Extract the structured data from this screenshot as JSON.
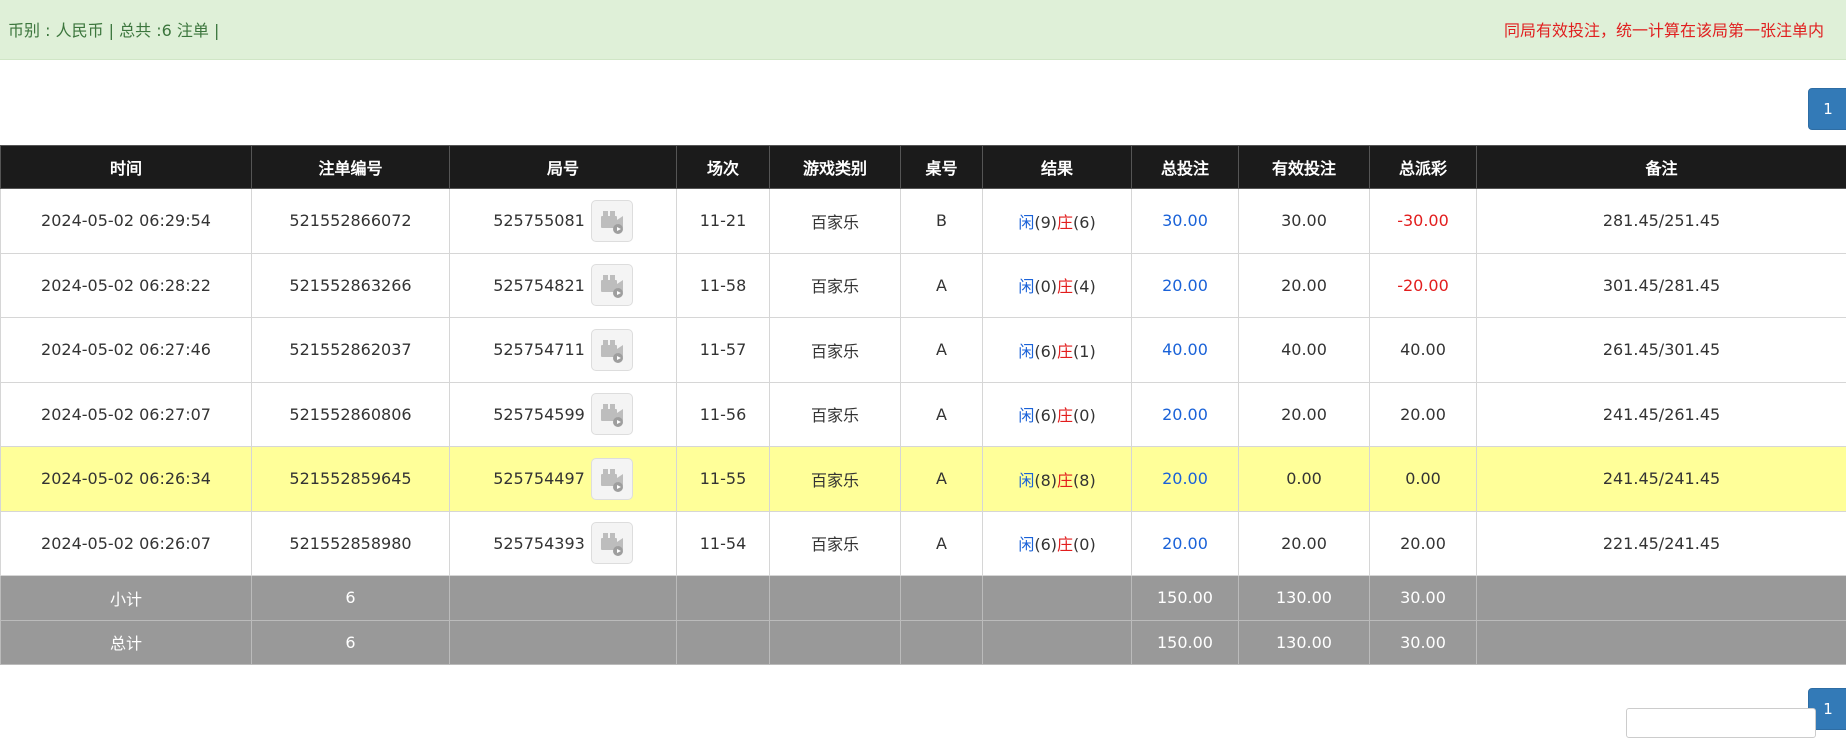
{
  "topbar": {
    "summary": "币别 : 人民币 | 总共 :6 注单 |",
    "notice": "同局有效投注，统一计算在该局第一张注单内"
  },
  "pagination": {
    "current_page": "1"
  },
  "table": {
    "headers": [
      "时间",
      "注单编号",
      "局号",
      "场次",
      "游戏类别",
      "桌号",
      "结果",
      "总投注",
      "有效投注",
      "总派彩",
      "备注"
    ],
    "rows": [
      {
        "time": "2024-05-02 06:29:54",
        "bet_id": "521552866072",
        "round": "525755081",
        "session": "11-21",
        "game": "百家乐",
        "table": "B",
        "player_label": "闲",
        "player_score": "(9)",
        "banker_label": "庄",
        "banker_score": "(6)",
        "total_bet": "30.00",
        "valid_bet": "30.00",
        "payout": "-30.00",
        "payout_negative": true,
        "note": "281.45/251.45",
        "highlight": false
      },
      {
        "time": "2024-05-02 06:28:22",
        "bet_id": "521552863266",
        "round": "525754821",
        "session": "11-58",
        "game": "百家乐",
        "table": "A",
        "player_label": "闲",
        "player_score": "(0)",
        "banker_label": "庄",
        "banker_score": "(4)",
        "total_bet": "20.00",
        "valid_bet": "20.00",
        "payout": "-20.00",
        "payout_negative": true,
        "note": "301.45/281.45",
        "highlight": false
      },
      {
        "time": "2024-05-02 06:27:46",
        "bet_id": "521552862037",
        "round": "525754711",
        "session": "11-57",
        "game": "百家乐",
        "table": "A",
        "player_label": "闲",
        "player_score": "(6)",
        "banker_label": "庄",
        "banker_score": "(1)",
        "total_bet": "40.00",
        "valid_bet": "40.00",
        "payout": "40.00",
        "payout_negative": false,
        "note": "261.45/301.45",
        "highlight": false
      },
      {
        "time": "2024-05-02 06:27:07",
        "bet_id": "521552860806",
        "round": "525754599",
        "session": "11-56",
        "game": "百家乐",
        "table": "A",
        "player_label": "闲",
        "player_score": "(6)",
        "banker_label": "庄",
        "banker_score": "(0)",
        "total_bet": "20.00",
        "valid_bet": "20.00",
        "payout": "20.00",
        "payout_negative": false,
        "note": "241.45/261.45",
        "highlight": false
      },
      {
        "time": "2024-05-02 06:26:34",
        "bet_id": "521552859645",
        "round": "525754497",
        "session": "11-55",
        "game": "百家乐",
        "table": "A",
        "player_label": "闲",
        "player_score": "(8)",
        "banker_label": "庄",
        "banker_score": "(8)",
        "total_bet": "20.00",
        "valid_bet": "0.00",
        "payout": "0.00",
        "payout_negative": false,
        "note": "241.45/241.45",
        "highlight": true
      },
      {
        "time": "2024-05-02 06:26:07",
        "bet_id": "521552858980",
        "round": "525754393",
        "session": "11-54",
        "game": "百家乐",
        "table": "A",
        "player_label": "闲",
        "player_score": "(6)",
        "banker_label": "庄",
        "banker_score": "(0)",
        "total_bet": "20.00",
        "valid_bet": "20.00",
        "payout": "20.00",
        "payout_negative": false,
        "note": "221.45/241.45",
        "highlight": false
      }
    ],
    "subtotal": {
      "label": "小计",
      "count": "6",
      "total_bet": "150.00",
      "valid_bet": "130.00",
      "payout": "30.00"
    },
    "grandtotal": {
      "label": "总计",
      "count": "6",
      "total_bet": "150.00",
      "valid_bet": "130.00",
      "payout": "30.00"
    }
  },
  "colors": {
    "header_bg": "#1b1b1b",
    "topbar_bg": "#dff0d8",
    "highlight_row": "#ffff99",
    "sum_row": "#999999",
    "blue_text": "#1a62d8",
    "red_text": "#e21d1d",
    "page_button": "#337ab7"
  },
  "icons": {
    "replay": "video-replay-icon"
  }
}
